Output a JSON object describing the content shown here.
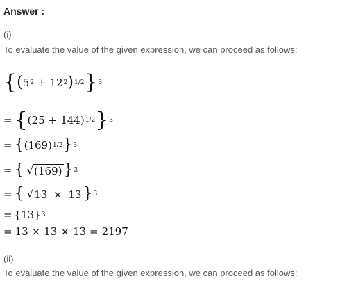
{
  "heading": "Answer :",
  "parts": [
    {
      "label": "(i)",
      "intro": "To evaluate the value of the given expression, we can proceed as follows:",
      "steps": [
        {
          "lead": "",
          "body": "(5² + 12²)^(1/2)",
          "outer_exp": "3"
        },
        {
          "lead": "=",
          "body": "(25 + 144)^(1/2)",
          "outer_exp": "3"
        },
        {
          "lead": "=",
          "body": "(169)^(1/2)",
          "outer_exp": "3"
        },
        {
          "lead": "=",
          "body": "√(169)",
          "outer_exp": "3"
        },
        {
          "lead": "=",
          "body": "√(13 × 13)",
          "outer_exp": "3"
        },
        {
          "lead": "=",
          "body": "13",
          "outer_exp": "3"
        },
        {
          "lead": "=",
          "body": "13 × 13 × 13 = 2197",
          "outer_exp": ""
        }
      ]
    },
    {
      "label": "(ii)",
      "intro": "To evaluate the value of the given expression, we can proceed as follows:"
    }
  ],
  "tokens": {
    "five": "5",
    "twelve": "12",
    "two": "2",
    "plus": "+",
    "half": "1/2",
    "three": "3",
    "eq": "=",
    "n25": "25",
    "n144": "144",
    "n169": "169",
    "n13": "13",
    "times": "×",
    "n2197": "2197",
    "open_paren": "(",
    "close_paren": ")",
    "open_brace": "{",
    "close_brace": "}",
    "radical": "√"
  }
}
